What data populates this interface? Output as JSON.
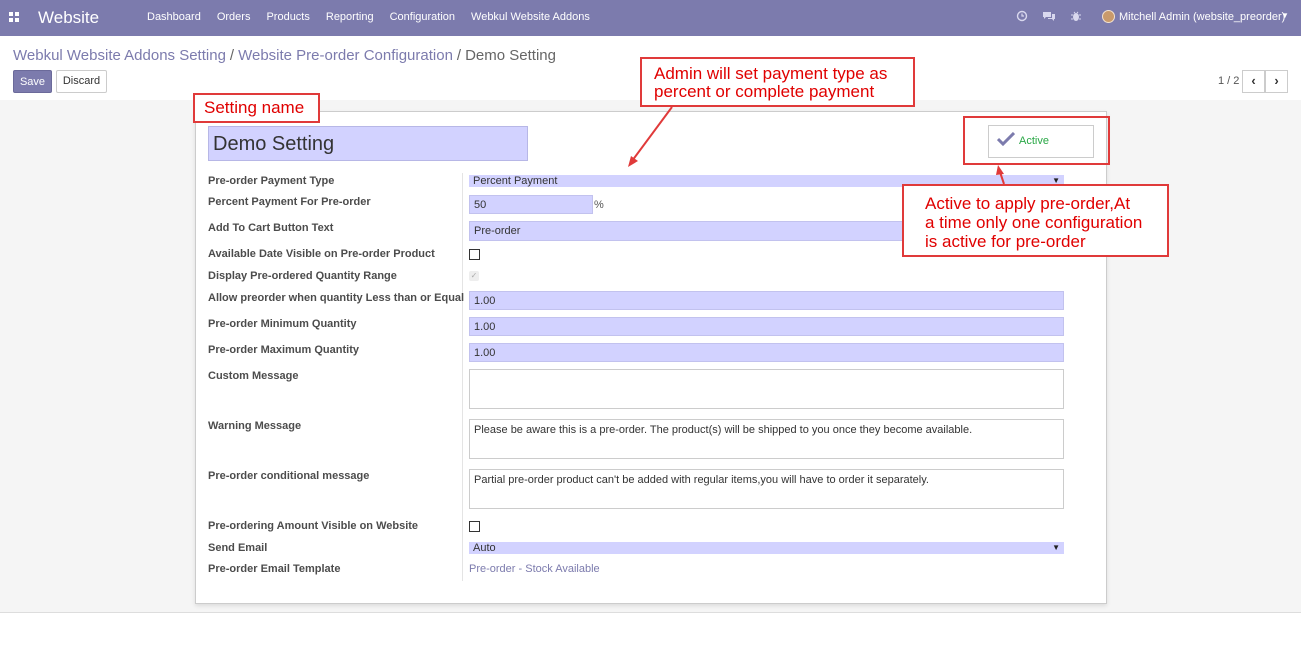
{
  "topbar": {
    "brand": "Website",
    "menu": [
      "Dashboard",
      "Orders",
      "Products",
      "Reporting",
      "Configuration",
      "Webkul Website Addons"
    ],
    "user": "Mitchell Admin (website_preorder)",
    "icons": [
      "clock-icon",
      "chat-icon",
      "bug-icon"
    ]
  },
  "breadcrumb": {
    "item1": "Webkul Website Addons Setting",
    "item2": "Website Pre-order Configuration",
    "current": "Demo Setting",
    "sep": "/"
  },
  "buttons": {
    "save": "Save",
    "discard": "Discard"
  },
  "pager": {
    "text": "1 / 2",
    "prev": "‹",
    "next": "›"
  },
  "form": {
    "name": "Demo Setting",
    "active_label": "Active",
    "fields": {
      "payment_type": {
        "label": "Pre-order Payment Type",
        "value": "Percent Payment"
      },
      "percent": {
        "label": "Percent Payment For Pre-order",
        "value": "50",
        "suffix": "%"
      },
      "cart_text": {
        "label": "Add To Cart Button Text",
        "value": "Pre-order"
      },
      "date_visible": {
        "label": "Available Date Visible on Pre-order Product",
        "checked": false
      },
      "qty_range": {
        "label": "Display Pre-ordered Quantity Range",
        "checked": true
      },
      "allow_preorder": {
        "label": "Allow preorder when quantity Less than or Equal",
        "value": "1.00"
      },
      "min_qty": {
        "label": "Pre-order Minimum Quantity",
        "value": "1.00"
      },
      "max_qty": {
        "label": "Pre-order Maximum Quantity",
        "value": "1.00"
      },
      "custom_msg": {
        "label": "Custom Message",
        "value": ""
      },
      "warning_msg": {
        "label": "Warning Message",
        "value": "Please be aware this is a pre-order. The product(s) will be shipped to you once they become available."
      },
      "conditional_msg": {
        "label": "Pre-order conditional message",
        "value": "Partial pre-order product can't be added with regular items,you will have to order it separately."
      },
      "amount_visible": {
        "label": "Pre-ordering Amount Visible on Website",
        "checked": false
      },
      "send_email": {
        "label": "Send Email",
        "value": "Auto"
      },
      "email_template": {
        "label": "Pre-order Email Template",
        "value": "Pre-order - Stock Available"
      }
    }
  },
  "annotations": {
    "setting_name": "Setting name",
    "payment_type_l1": "Admin will set payment type as",
    "payment_type_l2": "percent or complete payment",
    "active_l1": "Active to apply pre-order,At",
    "active_l2": "a time only one configuration",
    "active_l3": "is active for pre-order"
  },
  "colors": {
    "topbar": "#7c7bad",
    "input": "#d2d2ff",
    "annotation": "#e03a3a"
  }
}
